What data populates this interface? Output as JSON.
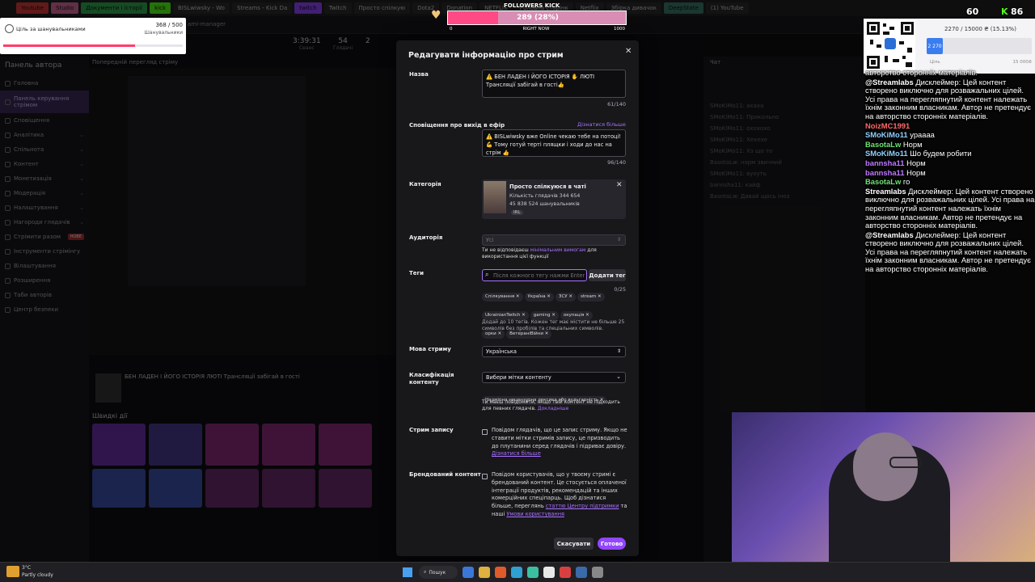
{
  "browser": {
    "tabs": [
      {
        "label": "Youtube",
        "color": "#d83a3a"
      },
      {
        "label": "Studio",
        "color": "#d86a9a"
      },
      {
        "label": "Документи і історії",
        "color": "#2fa84f"
      },
      {
        "label": "kick",
        "color": "#53fc18"
      },
      {
        "label": "BISLwiwsky - Wo",
        "color": "#2a2a2e"
      },
      {
        "label": "Streams - Kick Da",
        "color": "#2a2a2e"
      },
      {
        "label": "twitch",
        "color": "#9146ff"
      },
      {
        "label": "Twitch",
        "color": "#2a2a2e"
      },
      {
        "label": "Просто спілкую",
        "color": "#2a2a2e"
      },
      {
        "label": "Dota2",
        "color": "#2a2a2e"
      },
      {
        "label": "Donation",
        "color": "#2a2a2e"
      },
      {
        "label": "NETFLIX",
        "color": "#2a2a2e"
      },
      {
        "label": "Головна сторінк",
        "color": "#2a2a2e"
      },
      {
        "label": "Netflix",
        "color": "#2a2a2e"
      },
      {
        "label": "Збірка дивачок",
        "color": "#2a2a2e"
      },
      {
        "label": "DeepState",
        "color": "#3a7a6a"
      },
      {
        "label": "(1) YouTube",
        "color": "#2a2a2e"
      }
    ],
    "address_hint": "ami-manager"
  },
  "goal_widget": {
    "title": "Ціль за шанувальниками",
    "current": "368 / 500",
    "caption": "Шанувальники",
    "progress": 0.736
  },
  "followers_widget": {
    "title": "FOLLOWERS KICK",
    "value": "289 (28%)",
    "progress": 0.28,
    "min": "0",
    "mid": "RIGHT NOW",
    "max": "1000"
  },
  "stats": [
    {
      "value": "3:39:31",
      "label": "Сеанс"
    },
    {
      "value": "54",
      "label": "Глядачі"
    },
    {
      "value": "2",
      "label": ""
    }
  ],
  "sidebar": {
    "heading": "Панель автора",
    "items": [
      {
        "label": "Головна",
        "chev": false
      },
      {
        "label": "Панель керування стрімом",
        "chev": false,
        "active": true
      },
      {
        "label": "Сповіщення",
        "chev": false
      },
      {
        "label": "Аналітика",
        "chev": true
      },
      {
        "label": "Спільнота",
        "chev": true
      },
      {
        "label": "Контент",
        "chev": true
      },
      {
        "label": "Монетизація",
        "chev": true
      },
      {
        "label": "Модерація",
        "chev": true
      },
      {
        "label": "Налаштування",
        "chev": true
      },
      {
        "label": "Нагороди глядачів",
        "chev": true
      },
      {
        "label": "Стрімити разом",
        "chev": false,
        "badge": "НОВЕ"
      },
      {
        "label": "Інструменти стрімінгу",
        "chev": false
      },
      {
        "label": "Вілаштування",
        "chev": false
      },
      {
        "label": "Розширення",
        "chev": false
      },
      {
        "label": "Таби авторів",
        "chev": false
      },
      {
        "label": "Центр безпеки",
        "chev": false
      }
    ]
  },
  "main": {
    "preview_label": "Попередній перегляд стріму",
    "stream_title_line": "БЕН ЛАДЕН І ЙОГО ІСТОРІЯ ЛЮТІ Трансляції забігай в гості",
    "quick_actions_label": "Швидкі дії",
    "chat_header": "Чат"
  },
  "modal": {
    "title": "Редагувати інформацію про стрим",
    "title_field": {
      "label": "Назва",
      "value": "⚠️ БЕН ЛАДЕН І ЙОГО ІСТОРІЯ ✋ ЛЮТІ Трансляції забігай в гості👍",
      "counter": "61/140"
    },
    "notification": {
      "label": "Сповіщення про вихід в ефір",
      "learn_more": "Дізнатися більше",
      "value": "⚠️ BISLwiwsky вже Online чекаю тебе на потоці! 💪 Тому готуй терті плящки і ходи до нас на стрім 👍",
      "counter": "96/140"
    },
    "category": {
      "label": "Категорія",
      "name": "Просто спілкуюся в чаті",
      "viewers": "Кількість глядачів 344 654",
      "followers": "45 838 524 шанувальників",
      "tag": "IRL"
    },
    "audience": {
      "label": "Аудиторія",
      "value": "Усі",
      "note_a": "Ти не відповідаєш ",
      "note_link": "мінімальним вимогам",
      "note_b": " для використання цієї функції"
    },
    "tags": {
      "label": "Теги",
      "placeholder": "Після кожного тегу нажми Enter",
      "add_button": "Додати тег",
      "counter": "0/25",
      "chips": [
        "Спілкування",
        "Україна",
        "ЗСУ",
        "stream",
        "UkrainianTwitch",
        "gaming",
        "окупація",
        "орки",
        "ВетераніВійни"
      ],
      "hint": "Додай до 10 тегів. Кожен тег має містити не більше 25 символів без пробілів та спеціальних символів."
    },
    "language": {
      "label": "Мова стриму",
      "value": "Українська"
    },
    "classification": {
      "label": "Класифікація контенту",
      "value": "Вибери мітки контенту",
      "chip": "Надмірна нецензурна лексика або вульгарність",
      "note_a": "Ти маєш повідомити, якщо твій контент не підходить для певних глядачів. ",
      "note_link": "Докладніше"
    },
    "recording": {
      "label": "Стрим запису",
      "text": "Повідом глядачів, що це запис стриму. Якщо не ставити мітки стримів запису, це призводить до плутанини серед глядачів і підриває довіру.",
      "link": "Дізнатися більше"
    },
    "branded": {
      "label": "Брендований контент",
      "text": "Повідом користувачів, що у твоєму стримі є брендований контент. Це стосується оплаченої інтеграції продуктів, рекомендацій та інших комерційних спеціпарць. Щоб дізнатися більше, переглянь ",
      "link1": "статтю Центру підтримки",
      "mid": " та наші ",
      "link2": "Умови користування"
    },
    "cancel": "Скасувати",
    "done": "Готово"
  },
  "qr_panel": {
    "progress_text": "2270 / 15000 ₴ (15.13%)",
    "badge": "2 270",
    "left_caption": "Ціль",
    "right_caption": "15 000₴"
  },
  "viewer_counts": [
    {
      "value": "60",
      "color": "#53fc18"
    },
    {
      "value": "86",
      "color": "#53fc18"
    }
  ],
  "overlay_chat": [
    {
      "user": "",
      "text": "авторство сторонніх матеріалів.",
      "color": "#fff"
    },
    {
      "user": "@Streamlabs",
      "text": "Дисклеймер: Цей контент створено виключно для розважальних цілей. Усі права на перегляпнутий контент належать їхнім законним власникам. Автор не претендує на авторство сторонніх матеріалів.",
      "color": "#fff"
    },
    {
      "user": "NoizMC1991",
      "text": "",
      "color": "#ff6a6a"
    },
    {
      "user": "SMoKiMo11",
      "text": "ураааа",
      "color": "#8fd0ff"
    },
    {
      "user": "BasotaLw",
      "text": "Норм",
      "color": "#6ee26e"
    },
    {
      "user": "SMoKiMo11",
      "text": "Шо будем робити",
      "color": "#8fd0ff"
    },
    {
      "user": "bannsha11",
      "text": "Норм",
      "color": "#c07aff"
    },
    {
      "user": "bannsha11",
      "text": "Норм",
      "color": "#c07aff"
    },
    {
      "user": "BasotaLw",
      "text": "го",
      "color": "#6ee26e"
    },
    {
      "user": "Streamlabs",
      "text": "Дисклеймер: Цей контент створено виключно для розважальних цілей. Усі права на перегляпнутий контент належать їхнім законним власникам. Автор не претендує на авторство сторонніх матеріалів.",
      "color": "#fff"
    },
    {
      "user": "@Streamlabs",
      "text": "Дисклеймер: Цей контент створено виключно для розважальних цілей. Усі права на перегляпнутий контент належать їхнім законним власникам. Автор не претендує на авторство сторонніх матеріалів.",
      "color": "#fff"
    }
  ],
  "chat_lines": [
    "SMoKiMo11: ахаха",
    "SMoKiMo11: Прикольно",
    "SMoKiMo11: охохохо",
    "SMoKiMo11: Хехехе",
    "SMoKiMo11: Хз що то",
    "BasotaLw: норм звичний",
    "SMoKiMo11: вухуть",
    "bannsha11: кайф",
    "BasotaLw: Давай щось іноз"
  ],
  "weather": {
    "temp": "3°C",
    "text": "Partly cloudy"
  },
  "taskbar": {
    "search": "Пошук"
  },
  "colors": {
    "accent": "#9146ff",
    "progress_pink": "#ff3d6b",
    "kick_green": "#53fc18"
  }
}
